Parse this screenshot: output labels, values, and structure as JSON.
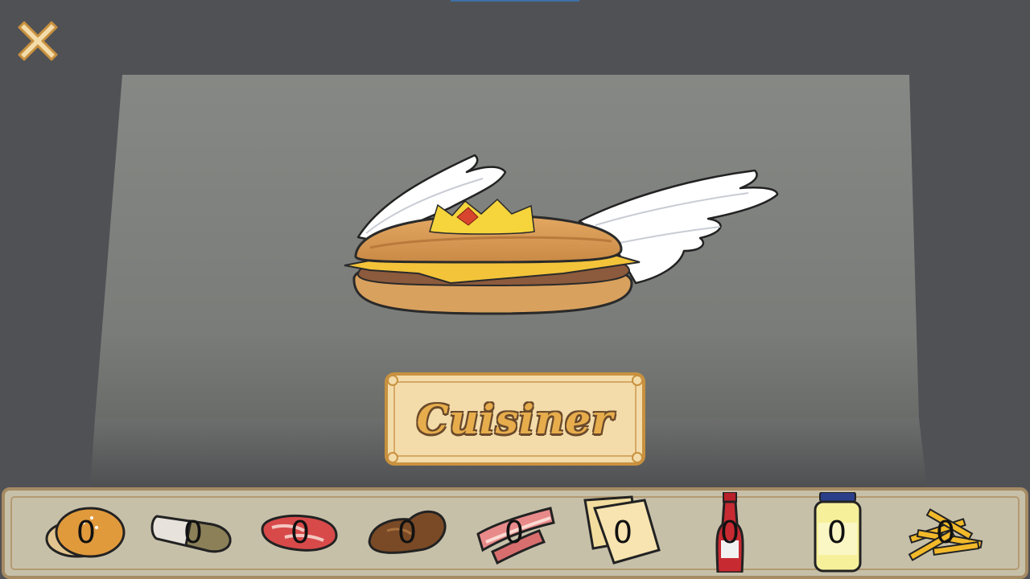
{
  "game": {
    "cook_button_label": "Cuisiner",
    "ingredients": [
      {
        "name": "bun",
        "count": "0"
      },
      {
        "name": "hotdog-roll",
        "count": "0"
      },
      {
        "name": "raw-steak",
        "count": "0"
      },
      {
        "name": "chicken-wings",
        "count": "0"
      },
      {
        "name": "bacon",
        "count": "0"
      },
      {
        "name": "cheese-slices",
        "count": "0"
      },
      {
        "name": "ketchup",
        "count": "0"
      },
      {
        "name": "mayonnaise",
        "count": "0"
      },
      {
        "name": "fries",
        "count": "0"
      }
    ]
  },
  "icons": {
    "close": "close-icon",
    "recipe": "winged-royal-burger-icon"
  },
  "colors": {
    "background": "#505155",
    "panel": "#888a87",
    "button_fill": "#f3dcaa",
    "button_text": "#e7ad4c",
    "bar_fill": "#c7c0a9"
  }
}
